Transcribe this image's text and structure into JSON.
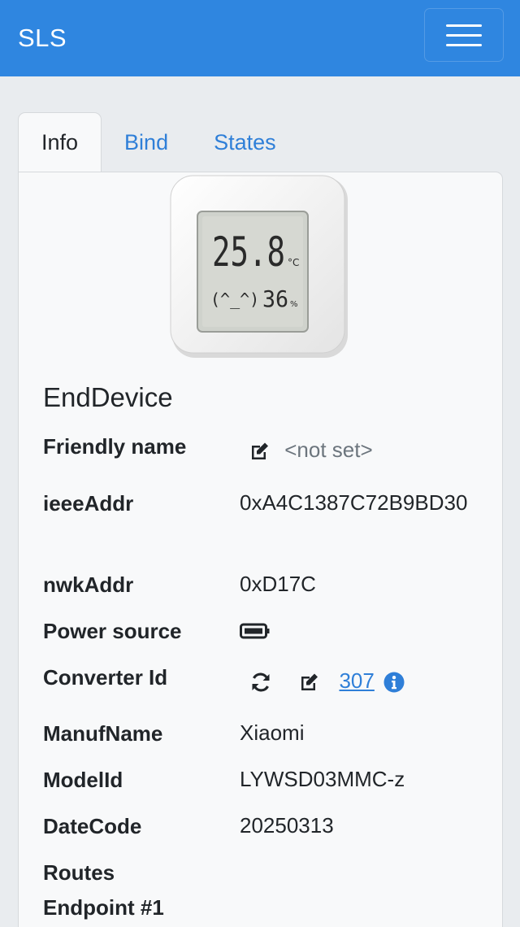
{
  "navbar": {
    "brand": "SLS"
  },
  "tabs": [
    {
      "label": "Info",
      "active": true
    },
    {
      "label": "Bind",
      "active": false
    },
    {
      "label": "States",
      "active": false
    }
  ],
  "device_image": {
    "display_temp": "25.8",
    "temp_unit": "°C",
    "face": "(^_^)",
    "humidity": "36",
    "humidity_unit": "%"
  },
  "device_type": "EndDevice",
  "fields": {
    "friendly_name": {
      "label": "Friendly name",
      "value": "<not set>"
    },
    "ieee_addr": {
      "label": "ieeeAddr",
      "value": "0xA4C1387C72B9BD30"
    },
    "nwk_addr": {
      "label": "nwkAddr",
      "value": "0xD17C"
    },
    "power_source": {
      "label": "Power source",
      "icon": "battery-icon"
    },
    "converter_id": {
      "label": "Converter Id",
      "value": "307"
    },
    "manuf_name": {
      "label": "ManufName",
      "value": "Xiaomi"
    },
    "model_id": {
      "label": "ModelId",
      "value": "LYWSD03MMC-z"
    },
    "date_code": {
      "label": "DateCode",
      "value": "20250313"
    },
    "routes": {
      "label": "Routes"
    },
    "endpoint": {
      "label": "Endpoint #1"
    }
  },
  "colors": {
    "navbar": "#2f86e0",
    "link": "#2f7fd8",
    "muted": "#6c757d",
    "info_icon": "#2f7fd8"
  }
}
